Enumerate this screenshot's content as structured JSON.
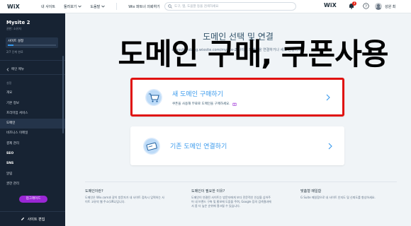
{
  "topbar": {
    "brand": "WiX",
    "nav": [
      {
        "label": "내 사이트",
        "dropdown": false
      },
      {
        "label": "둘러보기",
        "dropdown": true
      },
      {
        "label": "도움말",
        "dropdown": true
      },
      {
        "label": "Wix 파트너 의뢰하기",
        "dropdown": false
      }
    ],
    "search_placeholder": "도구, 앱, 도움말 등을 검색하세요",
    "wix_logo": "WiX",
    "notification_count": "3",
    "user_name": "성원 최"
  },
  "sidebar": {
    "site_name": "Mysite 2",
    "role": "권한: 소유자",
    "setup_label": "사이트 설정",
    "setup_progress": 0.12,
    "progress_text": "2/7 단계 완료",
    "back_label": "메인 메뉴",
    "items": [
      {
        "label": "설정",
        "type": "section"
      },
      {
        "label": "개요",
        "type": "normal"
      },
      {
        "label": "기본 정보",
        "type": "normal"
      },
      {
        "label": "프리미엄 서비스",
        "type": "normal"
      },
      {
        "label": "도메인",
        "type": "active"
      },
      {
        "label": "비즈니스 이메일",
        "type": "normal"
      },
      {
        "label": "결제 관리",
        "type": "normal"
      },
      {
        "label": "SEO",
        "type": "bold"
      },
      {
        "label": "SNS",
        "type": "bold"
      },
      {
        "label": "알림",
        "type": "normal"
      },
      {
        "label": "권한 관리",
        "type": "normal"
      }
    ],
    "upgrade_label": "업그레이드",
    "edit_label": "사이트 편집"
  },
  "main": {
    "title": "도메인 선택 및 연결",
    "subtitle": "chasubondang.wixsite.com/mysite-2 사이트 도메인을 연결하거나 새로 변경하세요",
    "overlay_text": "도메인 구매, 쿠폰사용",
    "cards": [
      {
        "title": "새 도메인 구매하기",
        "desc": "쿠폰을 사용해 무료로 도메인을 구매하세요.",
        "icon": "shopping-cart-icon"
      },
      {
        "title": "기존 도메인 연결하기",
        "desc": "",
        "icon": "domain-card-icon"
      }
    ],
    "footer": [
      {
        "heading": "도메인이란?",
        "body": "도메인은 Wix.com과 같이 방문자가 내 사이트 접속시 입력하는 사이트 고유의 웹 주소(URL)입니다."
      },
      {
        "heading": "도메인이 필요한 이유?",
        "body": "도메인이 연결된 사이트는 방문자에게 보다 전문적인 인상을 심어주어 내 브랜드 구축 및 홍보에 도움을 주며, Google 등의 검색결과에서 좀 더 높은 순위에 랭크될 수 있습니다."
      },
      {
        "heading": "맞춤형 메일함",
        "body": "G Suite 메일함으로 내 사이트 인지도 및 신뢰도를 향상하세요."
      }
    ]
  },
  "colors": {
    "accent": "#3899ec",
    "sidebar_bg": "#172333",
    "highlight_border": "#e0120f",
    "upgrade": "#9a27d5"
  }
}
